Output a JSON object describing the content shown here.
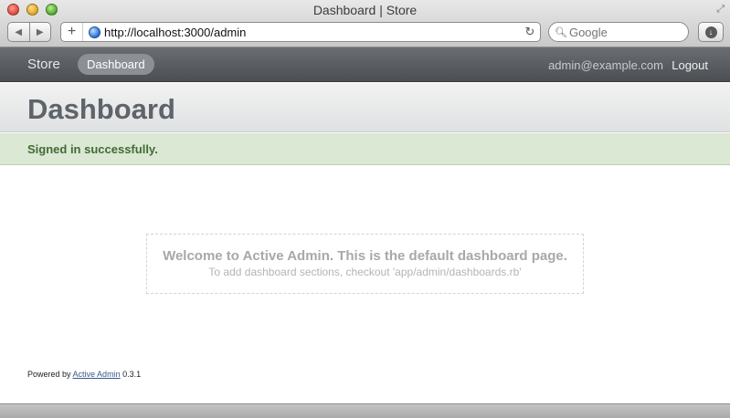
{
  "window": {
    "title": "Dashboard | Store",
    "url": "http://localhost:3000/admin",
    "search_placeholder": "Google"
  },
  "header": {
    "site_title": "Store",
    "tabs": [
      {
        "label": "Dashboard",
        "active": true
      }
    ],
    "user_email": "admin@example.com",
    "logout_label": "Logout"
  },
  "title_bar": {
    "title": "Dashboard"
  },
  "flash": {
    "notice": "Signed in successfully."
  },
  "blank_slate": {
    "title": "Welcome to Active Admin. This is the default dashboard page.",
    "subtitle": "To add dashboard sections, checkout 'app/admin/dashboards.rb'"
  },
  "footer": {
    "prefix": "Powered by",
    "link_label": "Active Admin",
    "version": "0.3.1"
  },
  "colors": {
    "header_bg": "#4b4f53",
    "title_text": "#5e6469",
    "flash_bg": "#dbe8d4",
    "flash_text": "#416b33"
  }
}
